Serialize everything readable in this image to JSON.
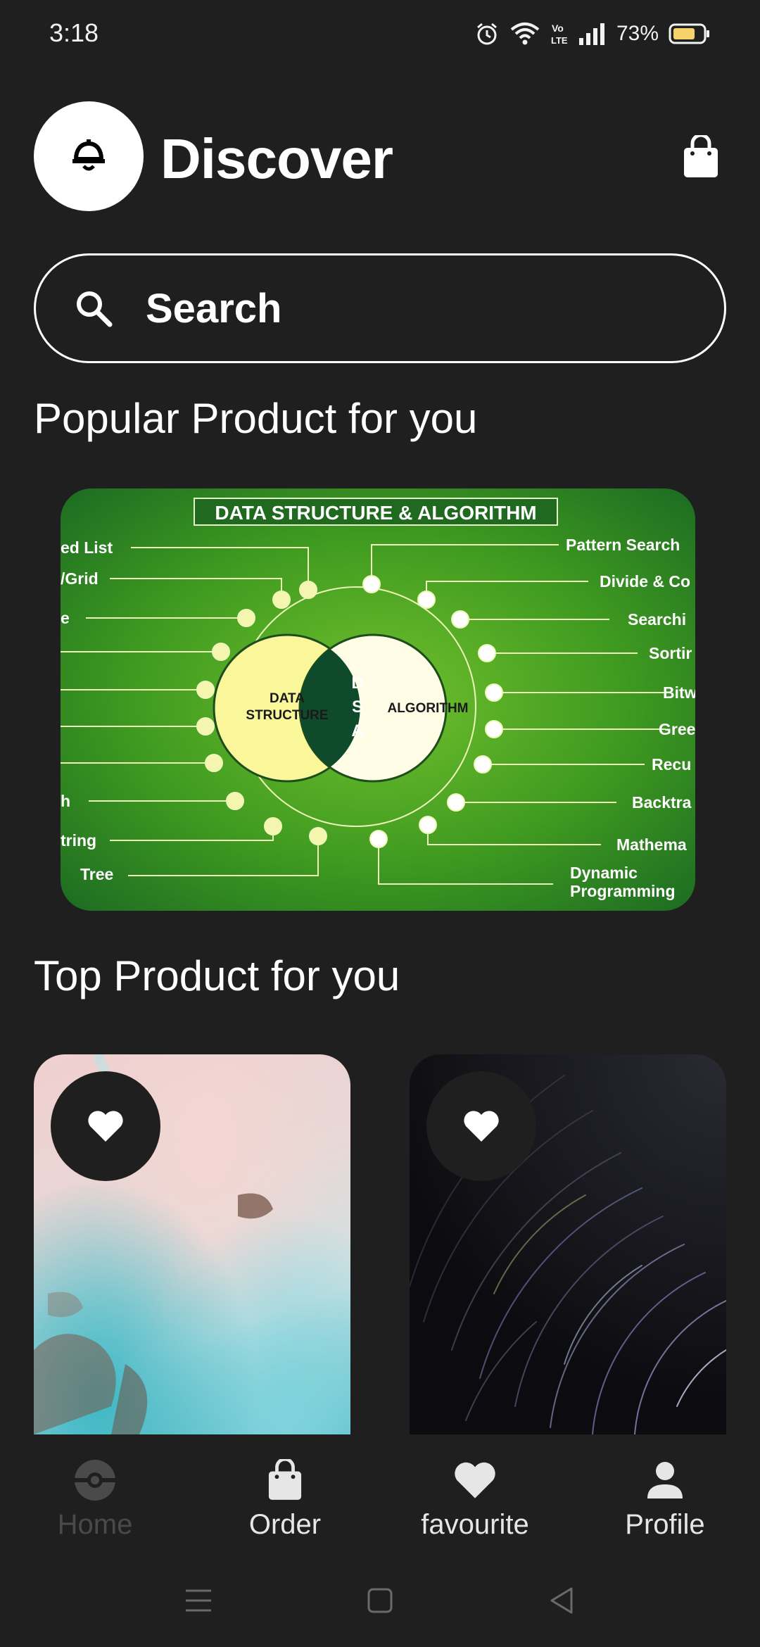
{
  "status_bar": {
    "time": "3:18",
    "battery": "73%",
    "volte": "Vo LTE"
  },
  "header": {
    "title": "Discover"
  },
  "search": {
    "placeholder": "Search"
  },
  "sections": {
    "popular": "Popular Product for you",
    "top": "Top Product for you"
  },
  "banner": {
    "heading": "DATA STRUCTURE & ALGORITHM",
    "left_circle": [
      "DATA",
      "STRUCTURE"
    ],
    "right_circle": "ALGORITHM",
    "center": [
      "D",
      "S",
      "A"
    ],
    "left_labels": [
      "ed List",
      "/Grid",
      "e",
      "h",
      "tring",
      "Tree"
    ],
    "right_labels": [
      "Pattern Search",
      "Divide & Co",
      "Searchi",
      "Sortir",
      "Bitw",
      "Gree",
      "Recu",
      "Backtra",
      "Mathema",
      "Dynamic",
      "Programming"
    ]
  },
  "bottom_nav": {
    "home": "Home",
    "order": "Order",
    "favourite": "favourite",
    "profile": "Profile"
  },
  "colors": {
    "background": "#1f1f1f",
    "banner_green": "#4ea823",
    "inactive": "#4a4a4a"
  }
}
